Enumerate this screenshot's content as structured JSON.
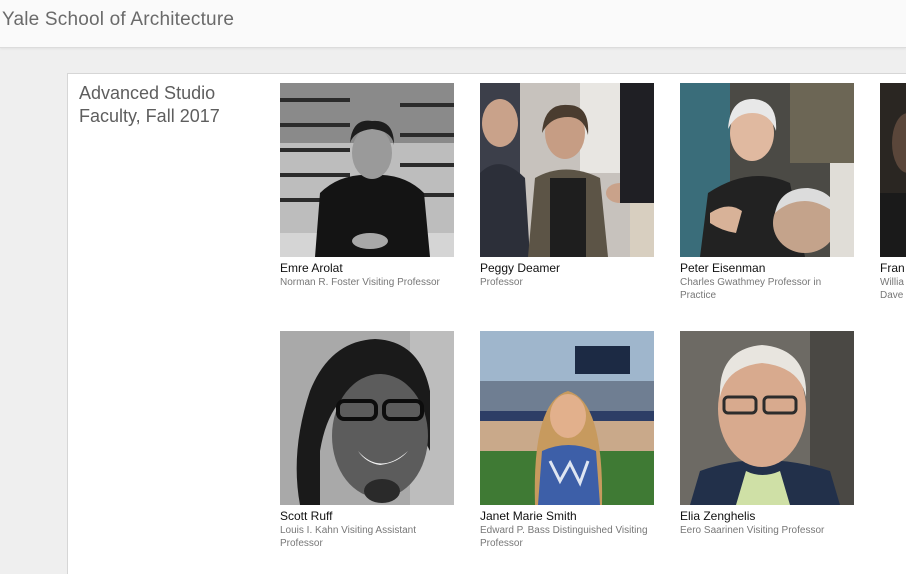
{
  "site": {
    "title": "Yale School of Architecture"
  },
  "section": {
    "heading_line1": "Advanced Studio",
    "heading_line2": "Faculty, Fall 2017"
  },
  "faculty": [
    {
      "name": "Emre Arolat",
      "title": "Norman R. Foster Visiting Professor"
    },
    {
      "name": "Peggy Deamer",
      "title": "Professor"
    },
    {
      "name": "Peter Eisenman",
      "title": "Charles Gwathmey Professor in Practice"
    },
    {
      "name": "Fran",
      "title_line1": "Willia",
      "title_line2": "Dave"
    },
    {
      "name": "Scott Ruff",
      "title": "Louis I. Kahn Visiting Assistant Professor"
    },
    {
      "name": "Janet Marie Smith",
      "title": "Edward P. Bass Distinguished Visiting Professor"
    },
    {
      "name": "Elia Zenghelis",
      "title": "Eero Saarinen Visiting Professor"
    }
  ]
}
